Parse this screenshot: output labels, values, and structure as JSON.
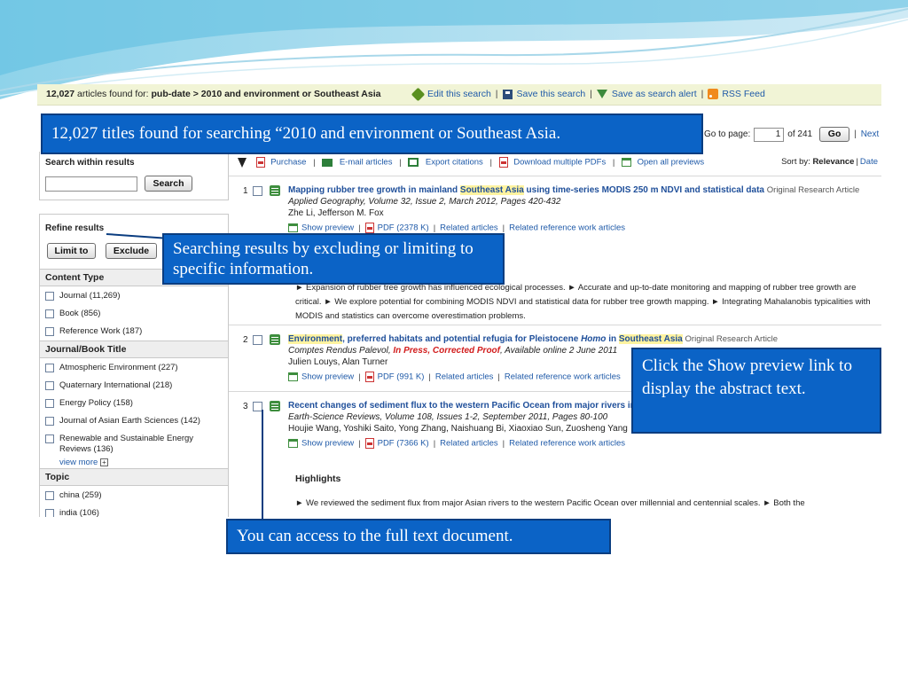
{
  "topbar": {
    "count": "12,027",
    "found_text": " articles found for: ",
    "query": "pub-date > 2010 and environment or Southeast Asia",
    "edit_search": "Edit this search",
    "save_search": "Save this search",
    "save_alert": "Save as search alert",
    "rss": "RSS Feed"
  },
  "paging": {
    "goto_label": "Go to page:",
    "page_value": "1",
    "of_total": "of 241",
    "go_button": "Go",
    "next": "Next »"
  },
  "sidebar": {
    "search_within": {
      "title": "Search within results",
      "input_value": "",
      "button": "Search"
    },
    "refine": {
      "title": "Refine results",
      "limit_button": "Limit to",
      "exclude_button": "Exclude"
    },
    "content_type": {
      "title": "Content Type",
      "items": [
        "Journal (11,269)",
        "Book (856)",
        "Reference Work (187)"
      ]
    },
    "journal_title": {
      "title": "Journal/Book Title",
      "items": [
        "Atmospheric Environment (227)",
        "Quaternary International (218)",
        "Energy Policy (158)",
        "Journal of Asian Earth Sciences (142)",
        "Renewable and Sustainable Energy Reviews (136)"
      ],
      "view_more": "view more"
    },
    "topic": {
      "title": "Topic",
      "items": [
        "china (259)",
        "india (106)"
      ]
    }
  },
  "toolbar": {
    "purchase": "Purchase",
    "email": "E-mail articles",
    "export": "Export citations",
    "download_pdfs": "Download multiple PDFs",
    "open_previews": "Open all previews",
    "sort_label": "Sort by: ",
    "sort_relevance": "Relevance",
    "sort_date": "Date"
  },
  "results": [
    {
      "num": "1",
      "title_pre": "Mapping rubber tree growth in mainland ",
      "title_hl": "Southeast Asia",
      "title_post": " using time-series MODIS 250 m NDVI and statistical data",
      "type": "Original Research Article",
      "source": "Applied Geography, Volume 32, Issue 2, March 2012, Pages 420-432",
      "authors": "Zhe Li, Jefferson M. Fox",
      "show_preview": "Show preview",
      "pdf": "PDF (2378 K)",
      "related": "Related articles",
      "related_ref": "Related reference work articles",
      "abstract": "► Expansion of rubber tree growth has influenced ecological processes. ► Accurate and up-to-date monitoring and mapping of rubber tree growth are critical. ► We explore potential for combining MODIS NDVI and statistical data for rubber tree growth mapping. ► Integrating Mahalanobis typicalities with MODIS and statistics can overcome overestimation problems."
    },
    {
      "num": "2",
      "title_hl1": "Environment",
      "title_mid": ", preferred habitats and potential refugia for Pleistocene ",
      "title_italic": "Homo",
      "title_in": " in ",
      "title_hl2": "Southeast Asia",
      "type": "Original Research Article",
      "source_pre": "Comptes Rendus Palevol, ",
      "in_press": "In Press, Corrected Proof",
      "source_post": ", Available online 2 June 2011",
      "authors": "Julien Louys, Alan Turner",
      "show_preview": "Show preview",
      "pdf": "PDF (991 K)",
      "related": "Related articles",
      "related_ref": "Related reference work articles"
    },
    {
      "num": "3",
      "title": "Recent changes of sediment flux to the western Pacific Ocean from major rivers in",
      "source": "Earth-Science Reviews, Volume 108, Issues 1-2, September 2011, Pages 80-100",
      "authors": "Houjie Wang, Yoshiki Saito, Yong Zhang, Naishuang Bi, Xiaoxiao Sun, Zuosheng Yang",
      "show_preview": "Show preview",
      "pdf": "PDF (7366 K)",
      "related": "Related articles",
      "related_ref": "Related reference work articles",
      "highlights_title": "Highlights",
      "highlights_text": "► We reviewed the sediment flux from major Asian rivers to the western Pacific Ocean over millennial and centennial scales. ► Both the"
    }
  ],
  "callouts": {
    "titles_found": "12,027 titles found for searching “2010 and environment or Southeast Asia.",
    "refine": "Searching results by excluding or limiting to specific information.",
    "preview": "Click the Show preview link to display the abstract text.",
    "full_text": "You can access to the full text document."
  },
  "colors": {
    "callout_bg": "#0b63c6",
    "topbar_bg": "#f1f4d6",
    "link": "#1f5aa8",
    "highlight": "#fff3a0",
    "in_press": "#d21d1d"
  }
}
